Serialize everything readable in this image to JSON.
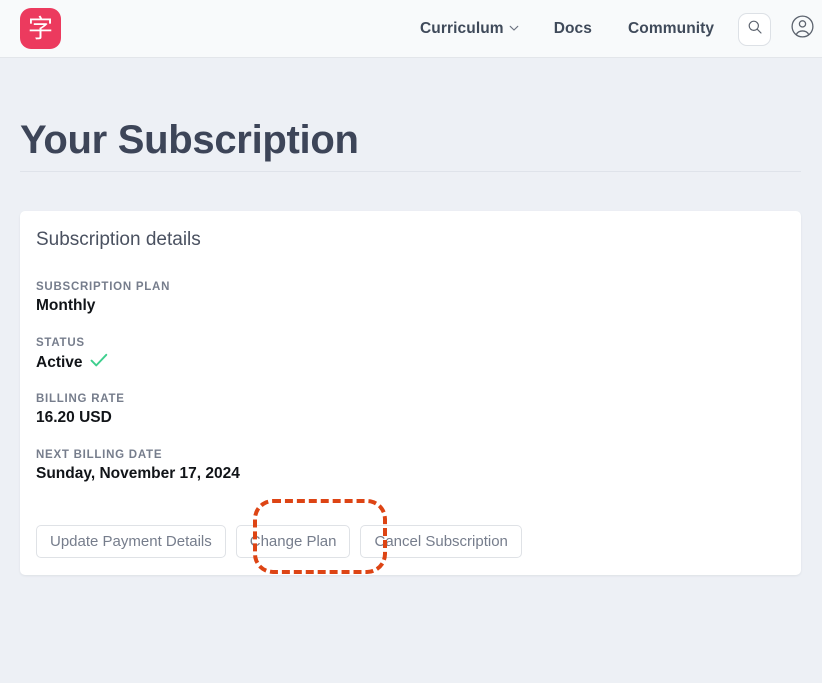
{
  "nav": {
    "logo_glyph": "字",
    "logo_name": "site-logo",
    "logo_color": "#ec3a5e",
    "links": [
      {
        "label": "Curriculum",
        "has_dropdown": true
      },
      {
        "label": "Docs",
        "has_dropdown": false
      },
      {
        "label": "Community",
        "has_dropdown": false
      }
    ],
    "search_icon": "search-icon",
    "account_icon": "account-circle-icon"
  },
  "page": {
    "title": "Your Subscription"
  },
  "card": {
    "heading": "Subscription details",
    "fields": [
      {
        "label": "SUBSCRIPTION PLAN",
        "value": "Monthly",
        "status_icon": ""
      },
      {
        "label": "STATUS",
        "value": "Active",
        "status_icon": "green-check-icon"
      },
      {
        "label": "BILLING RATE",
        "value": "16.20 USD",
        "status_icon": ""
      },
      {
        "label": "NEXT BILLING DATE",
        "value": "Sunday, November 17, 2024",
        "status_icon": ""
      }
    ],
    "buttons": [
      {
        "label": "Update Payment Details"
      },
      {
        "label": "Change Plan"
      },
      {
        "label": "Cancel Subscription"
      }
    ]
  },
  "annotation": {
    "target": "Change Plan",
    "color": "#dd4414",
    "style": "dashed-rounded-rectangle"
  },
  "colors": {
    "page_background": "#edf0f5",
    "card_background": "#ffffff",
    "title_text": "#3d4558",
    "status_green": "#3ecf8e",
    "highlight": "#dd4414"
  }
}
